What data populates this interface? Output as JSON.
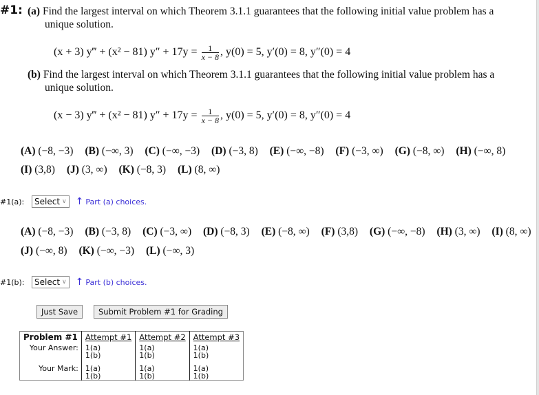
{
  "problem": {
    "number_label": "#1:",
    "part_a": {
      "label": "(a)",
      "text_line1": "Find the largest interval on which Theorem 3.1.1 guarantees that the following initial value problem has a",
      "text_line2": "unique solution.",
      "equation_lhs": "(x + 3) y‴ + (x² − 81) y″ + 17y  =",
      "fraction_num": "1",
      "fraction_den": "x − 8",
      "initial_conditions": ",   y(0) = 5,  y′(0) = 8,  y″(0) = 4"
    },
    "part_b": {
      "label": "(b)",
      "text_line1": "Find the largest interval on which Theorem 3.1.1 guarantees that the following initial value problem has a",
      "text_line2": "unique solution.",
      "equation_lhs": "(x − 3) y‴ + (x² − 81) y″ + 17y  =",
      "fraction_num": "1",
      "fraction_den": "x − 8",
      "initial_conditions": ",   y(0) = 5,  y′(0) = 8,  y″(0) = 4"
    }
  },
  "choices_a": [
    {
      "letter": "(A)",
      "value": "(−8, −3)"
    },
    {
      "letter": "(B)",
      "value": "(−∞, 3)"
    },
    {
      "letter": "(C)",
      "value": "(−∞, −3)"
    },
    {
      "letter": "(D)",
      "value": "(−3, 8)"
    },
    {
      "letter": "(E)",
      "value": "(−∞, −8)"
    },
    {
      "letter": "(F)",
      "value": "(−3, ∞)"
    },
    {
      "letter": "(G)",
      "value": "(−8, ∞)"
    },
    {
      "letter": "(H)",
      "value": "(−∞, 8)"
    },
    {
      "letter": "(I)",
      "value": "(3,8)"
    },
    {
      "letter": "(J)",
      "value": "(3, ∞)"
    },
    {
      "letter": "(K)",
      "value": "(−8, 3)"
    },
    {
      "letter": "(L)",
      "value": "(8, ∞)"
    }
  ],
  "choices_b": [
    {
      "letter": "(A)",
      "value": "(−8, −3)"
    },
    {
      "letter": "(B)",
      "value": "(−3, 8)"
    },
    {
      "letter": "(C)",
      "value": "(−3, ∞)"
    },
    {
      "letter": "(D)",
      "value": "(−8, 3)"
    },
    {
      "letter": "(E)",
      "value": "(−8, ∞)"
    },
    {
      "letter": "(F)",
      "value": "(3,8)"
    },
    {
      "letter": "(G)",
      "value": "(−∞, −8)"
    },
    {
      "letter": "(H)",
      "value": "(3, ∞)"
    },
    {
      "letter": "(I)",
      "value": "(8, ∞)"
    },
    {
      "letter": "(J)",
      "value": "(−∞, 8)"
    },
    {
      "letter": "(K)",
      "value": "(−∞, −3)"
    },
    {
      "letter": "(L)",
      "value": "(−∞, 3)"
    }
  ],
  "answer_a": {
    "label": "#1(a):",
    "select_value": "Select",
    "hint": "Part (a) choices."
  },
  "answer_b": {
    "label": "#1(b):",
    "select_value": "Select",
    "hint": "Part (b) choices."
  },
  "buttons": {
    "save": "Just Save",
    "submit": "Submit Problem #1 for Grading"
  },
  "attempts_table": {
    "header": "Problem #1",
    "attempts": [
      "Attempt #1",
      "Attempt #2",
      "Attempt #3"
    ],
    "your_answer_label": "Your Answer:",
    "your_mark_label": "Your Mark:",
    "parts": [
      "1(a)",
      "1(b)"
    ]
  },
  "colors": {
    "hint": "#3a2ed6"
  }
}
